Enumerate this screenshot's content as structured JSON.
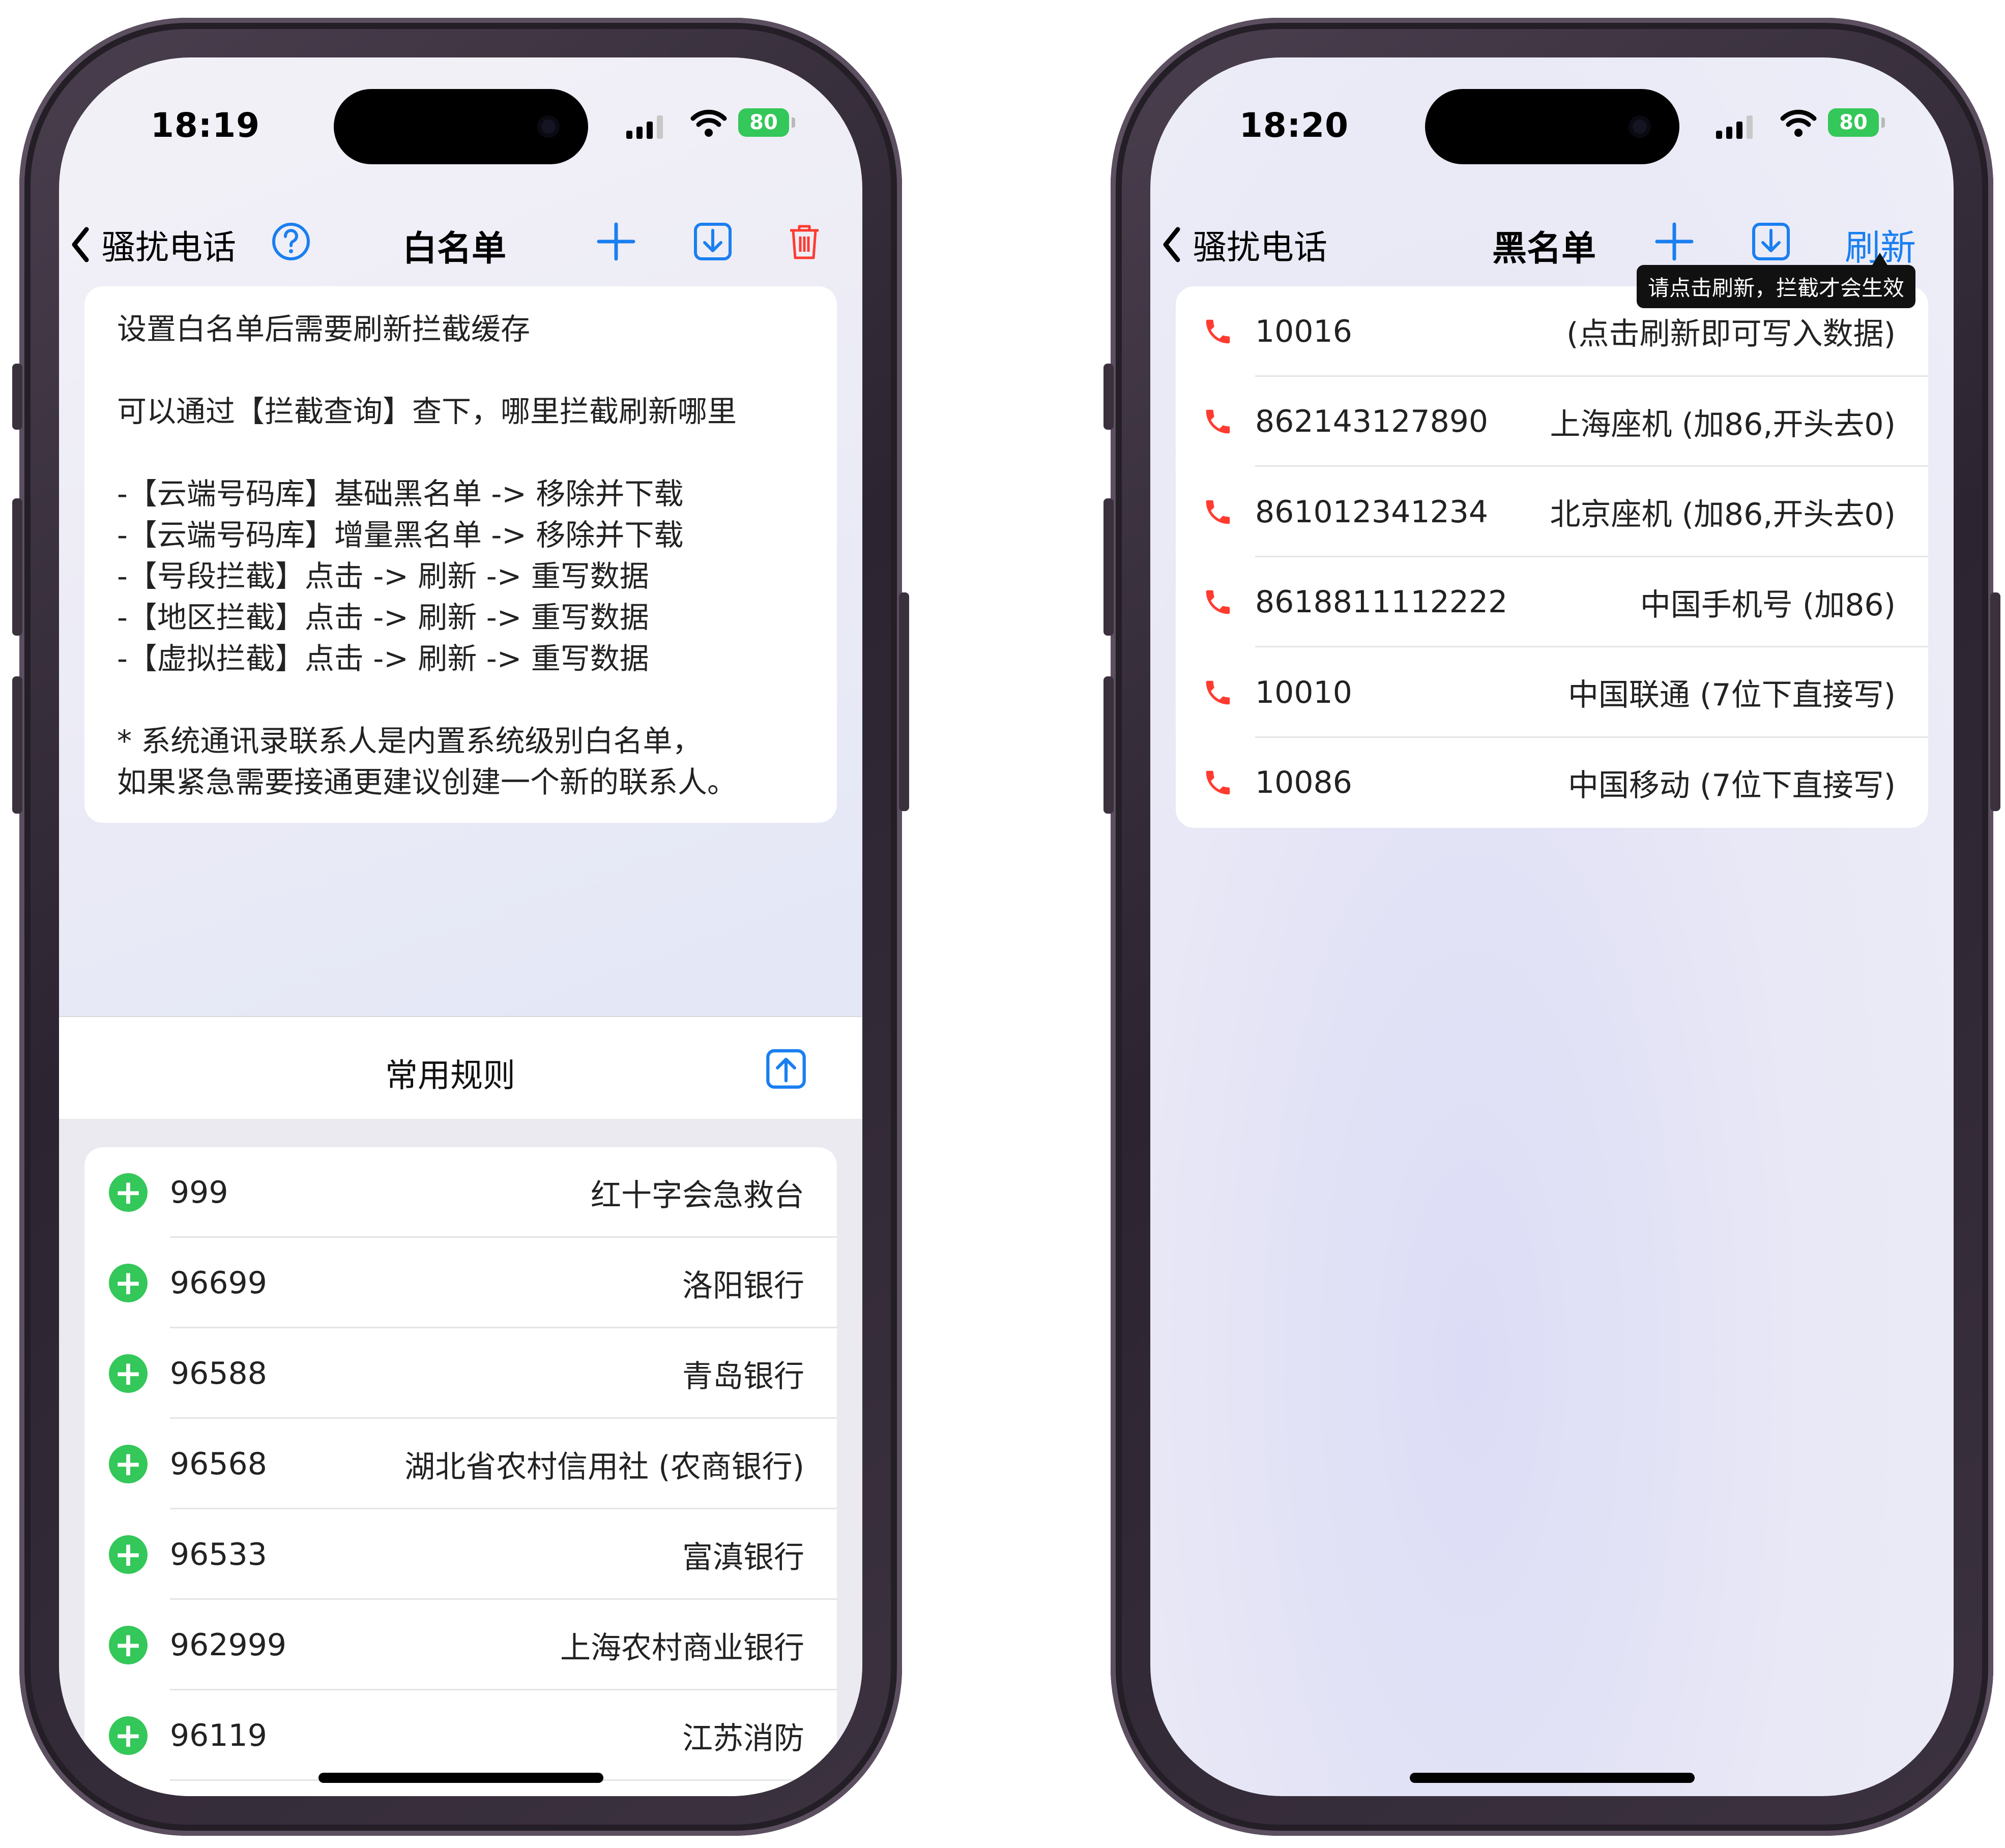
{
  "left_phone": {
    "status": {
      "time": "18:19",
      "battery": "80"
    },
    "nav": {
      "back_label": "骚扰电话",
      "title": "白名单"
    },
    "info_lines": [
      "设置白名单后需要刷新拦截缓存",
      "",
      "可以通过【拦截查询】查下，哪里拦截刷新哪里",
      "",
      "-【云端号码库】基础黑名单 -> 移除并下载",
      "-【云端号码库】增量黑名单 -> 移除并下载",
      "-【号段拦截】点击 -> 刷新 -> 重写数据",
      "-【地区拦截】点击 -> 刷新 -> 重写数据",
      "-【虚拟拦截】点击 -> 刷新 -> 重写数据",
      "",
      "* 系统通讯录联系人是内置系统级别白名单，",
      "如果紧急需要接通更建议创建一个新的联系人。"
    ],
    "sheet_title": "常用规则",
    "rules": [
      {
        "number": "999",
        "label": "红十字会急救台"
      },
      {
        "number": "96699",
        "label": "洛阳银行"
      },
      {
        "number": "96588",
        "label": "青岛银行"
      },
      {
        "number": "96568",
        "label": "湖北省农村信用社 (农商银行)"
      },
      {
        "number": "96533",
        "label": "富滇银行"
      },
      {
        "number": "962999",
        "label": "上海农村商业银行"
      },
      {
        "number": "96119",
        "label": "江苏消防"
      }
    ]
  },
  "right_phone": {
    "status": {
      "time": "18:20",
      "battery": "80"
    },
    "nav": {
      "back_label": "骚扰电话",
      "title": "黑名单",
      "refresh_label": "刷新"
    },
    "tooltip": "请点击刷新，拦截才会生效",
    "entries": [
      {
        "number": "10016",
        "label": "(点击刷新即可写入数据)"
      },
      {
        "number": "862143127890",
        "label": "上海座机 (加86,开头去0)"
      },
      {
        "number": "861012341234",
        "label": "北京座机 (加86,开头去0)"
      },
      {
        "number": "8618811112222",
        "label": "中国手机号 (加86)"
      },
      {
        "number": "10010",
        "label": "中国联通 (7位下直接写)"
      },
      {
        "number": "10086",
        "label": "中国移动 (7位下直接写)"
      }
    ]
  },
  "colors": {
    "accent": "#1a7ff0",
    "delete": "#ff3b30",
    "add": "#34c759",
    "call": "#ff3b30"
  }
}
